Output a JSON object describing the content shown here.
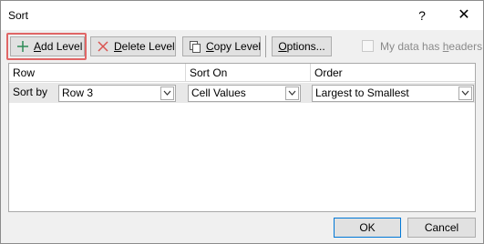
{
  "dialog": {
    "title": "Sort",
    "help_label": "?",
    "close_label": "✕"
  },
  "toolbar": {
    "add_level_access": "A",
    "add_level_rest": "dd Level",
    "delete_level_access": "D",
    "delete_level_rest": "elete Level",
    "copy_level_access": "C",
    "copy_level_rest": "opy Level",
    "options_access": "O",
    "options_rest": "ptions...",
    "headers_checkbox_pre": "My data has ",
    "headers_checkbox_access": "h",
    "headers_checkbox_post": "eaders",
    "headers_checked": false
  },
  "grid": {
    "columns": [
      "Row",
      "Sort On",
      "Order"
    ],
    "rows": [
      {
        "label": "Sort by",
        "row": "Row 3",
        "sort_on": "Cell Values",
        "order": "Largest to Smallest"
      }
    ]
  },
  "footer": {
    "ok_label": "OK",
    "cancel_label": "Cancel"
  },
  "colors": {
    "highlight_box": "#e06666",
    "add_icon": "#2e8b57",
    "delete_icon": "#d9534f",
    "default_button_border": "#0078d7"
  },
  "icons": {
    "add": "plus-icon",
    "delete": "x-icon",
    "copy": "copy-icon",
    "dropdown": "chevron-down-icon"
  }
}
